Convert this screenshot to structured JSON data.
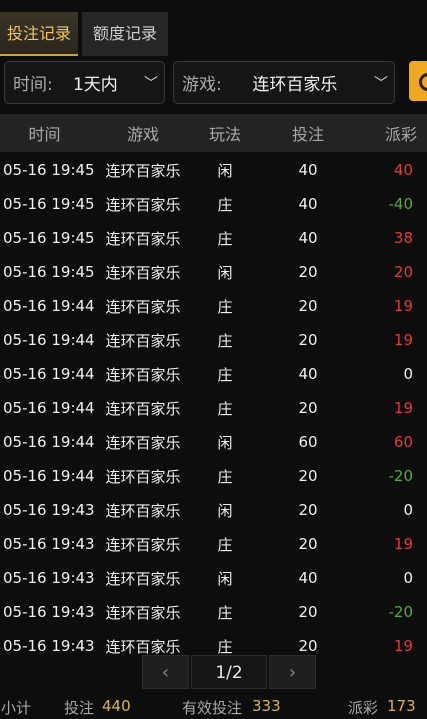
{
  "tabs": {
    "bets": "投注记录",
    "quota": "额度记录"
  },
  "filters": {
    "time": {
      "label": "时间:",
      "value": "1天内"
    },
    "game": {
      "label": "游戏:",
      "value": "连环百家乐"
    }
  },
  "table": {
    "headers": [
      "时间",
      "游戏",
      "玩法",
      "投注",
      "派彩"
    ],
    "rows": [
      {
        "time": "05-16 19:45",
        "game": "连环百家乐",
        "play": "闲",
        "bet": "40",
        "payout": "40",
        "sign": "pos"
      },
      {
        "time": "05-16 19:45",
        "game": "连环百家乐",
        "play": "庄",
        "bet": "40",
        "payout": "-40",
        "sign": "neg"
      },
      {
        "time": "05-16 19:45",
        "game": "连环百家乐",
        "play": "庄",
        "bet": "40",
        "payout": "38",
        "sign": "pos"
      },
      {
        "time": "05-16 19:45",
        "game": "连环百家乐",
        "play": "闲",
        "bet": "20",
        "payout": "20",
        "sign": "pos"
      },
      {
        "time": "05-16 19:44",
        "game": "连环百家乐",
        "play": "庄",
        "bet": "20",
        "payout": "19",
        "sign": "pos"
      },
      {
        "time": "05-16 19:44",
        "game": "连环百家乐",
        "play": "庄",
        "bet": "20",
        "payout": "19",
        "sign": "pos"
      },
      {
        "time": "05-16 19:44",
        "game": "连环百家乐",
        "play": "庄",
        "bet": "40",
        "payout": "0",
        "sign": "zero"
      },
      {
        "time": "05-16 19:44",
        "game": "连环百家乐",
        "play": "庄",
        "bet": "20",
        "payout": "19",
        "sign": "pos"
      },
      {
        "time": "05-16 19:44",
        "game": "连环百家乐",
        "play": "闲",
        "bet": "60",
        "payout": "60",
        "sign": "pos"
      },
      {
        "time": "05-16 19:44",
        "game": "连环百家乐",
        "play": "庄",
        "bet": "20",
        "payout": "-20",
        "sign": "neg"
      },
      {
        "time": "05-16 19:43",
        "game": "连环百家乐",
        "play": "闲",
        "bet": "20",
        "payout": "0",
        "sign": "zero"
      },
      {
        "time": "05-16 19:43",
        "game": "连环百家乐",
        "play": "庄",
        "bet": "20",
        "payout": "19",
        "sign": "pos"
      },
      {
        "time": "05-16 19:43",
        "game": "连环百家乐",
        "play": "闲",
        "bet": "40",
        "payout": "0",
        "sign": "zero"
      },
      {
        "time": "05-16 19:43",
        "game": "连环百家乐",
        "play": "庄",
        "bet": "20",
        "payout": "-20",
        "sign": "neg"
      },
      {
        "time": "05-16 19:43",
        "game": "连环百家乐",
        "play": "庄",
        "bet": "20",
        "payout": "19",
        "sign": "pos"
      }
    ]
  },
  "pager": {
    "prev": "‹",
    "page": "1/2",
    "next": "›"
  },
  "footer": {
    "subtotal_label": "小计",
    "bet_label": "投注",
    "bet_value": "440",
    "valid_label": "有效投注",
    "valid_value": "333",
    "payout_label": "派彩",
    "payout_value": "173"
  },
  "colors": {
    "accent": "#f0a91e",
    "positive": "#e03a3a",
    "negative": "#4fae3a"
  }
}
